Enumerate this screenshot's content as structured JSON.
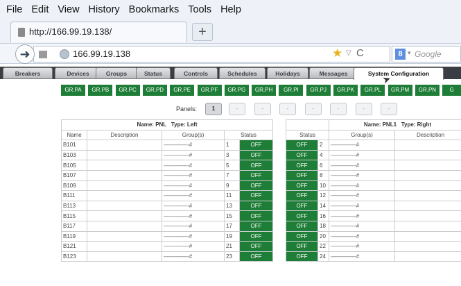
{
  "menubar": [
    "File",
    "Edit",
    "View",
    "History",
    "Bookmarks",
    "Tools",
    "Help"
  ],
  "browser": {
    "tab_title": "http://166.99.19.138/",
    "new_tab": "+",
    "url": "166.99.19.138",
    "search_placeholder": "Google",
    "search_engine_letter": "8"
  },
  "app_tabs": [
    "Breakers",
    "Devices",
    "Groups",
    "Status",
    "Controls",
    "Schedules",
    "Holidays",
    "Messages",
    "System Configuration"
  ],
  "active_tab": "System Configuration",
  "group_buttons": [
    "GR.PA",
    "GR.PB",
    "GR.PC",
    "GR.PD",
    "GR.PE",
    "GR.PF",
    "GR.PG",
    "GR.PH",
    "GR.PI",
    "GR.PJ",
    "GR.PK",
    "GR.PL",
    "GR.PM",
    "GR.PN",
    "G"
  ],
  "panels": {
    "label": "Panels:",
    "selected": "1",
    "others": [
      "-",
      "-",
      "-",
      "-",
      "-",
      "-",
      "-"
    ]
  },
  "left_panel": {
    "name_label": "Name: PNL",
    "type_label": "Type: Left",
    "columns": [
      "Name",
      "Description",
      "Group(s)",
      "Status"
    ],
    "rows": [
      {
        "name": "B101",
        "groups": "-----------------#",
        "num": "1",
        "status": "OFF"
      },
      {
        "name": "B103",
        "groups": "-----------------#",
        "num": "3",
        "status": "OFF"
      },
      {
        "name": "B105",
        "groups": "-----------------#",
        "num": "5",
        "status": "OFF"
      },
      {
        "name": "B107",
        "groups": "-----------------#",
        "num": "7",
        "status": "OFF"
      },
      {
        "name": "B109",
        "groups": "-----------------#",
        "num": "9",
        "status": "OFF"
      },
      {
        "name": "B111",
        "groups": "-----------------#",
        "num": "11",
        "status": "OFF"
      },
      {
        "name": "B113",
        "groups": "-----------------#",
        "num": "13",
        "status": "OFF"
      },
      {
        "name": "B115",
        "groups": "-----------------#",
        "num": "15",
        "status": "OFF"
      },
      {
        "name": "B117",
        "groups": "-----------------#",
        "num": "17",
        "status": "OFF"
      },
      {
        "name": "B119",
        "groups": "-----------------#",
        "num": "19",
        "status": "OFF"
      },
      {
        "name": "B121",
        "groups": "-----------------#",
        "num": "21",
        "status": "OFF"
      },
      {
        "name": "B123",
        "groups": "-----------------#",
        "num": "23",
        "status": "OFF"
      }
    ]
  },
  "right_panel": {
    "name_label": "Name: PNL1",
    "type_label": "Type: Right",
    "columns": [
      "Status",
      "Group(s)",
      "Description"
    ],
    "rows": [
      {
        "num": "2",
        "groups": "-----------------#",
        "status": "OFF"
      },
      {
        "num": "4",
        "groups": "-----------------#",
        "status": "OFF"
      },
      {
        "num": "6",
        "groups": "-----------------#",
        "status": "OFF"
      },
      {
        "num": "8",
        "groups": "-----------------#",
        "status": "OFF"
      },
      {
        "num": "10",
        "groups": "-----------------#",
        "status": "OFF"
      },
      {
        "num": "12",
        "groups": "-----------------#",
        "status": "OFF"
      },
      {
        "num": "14",
        "groups": "-----------------#",
        "status": "OFF"
      },
      {
        "num": "16",
        "groups": "-----------------#",
        "status": "OFF"
      },
      {
        "num": "18",
        "groups": "-----------------#",
        "status": "OFF"
      },
      {
        "num": "20",
        "groups": "-----------------#",
        "status": "OFF"
      },
      {
        "num": "22",
        "groups": "-----------------#",
        "status": "OFF"
      },
      {
        "num": "24",
        "groups": "-----------------#",
        "status": "OFF"
      }
    ]
  },
  "colors": {
    "status_off": "#1e7d36",
    "group_button": "#1e7d36",
    "tab_bar": "#3a3e44"
  }
}
